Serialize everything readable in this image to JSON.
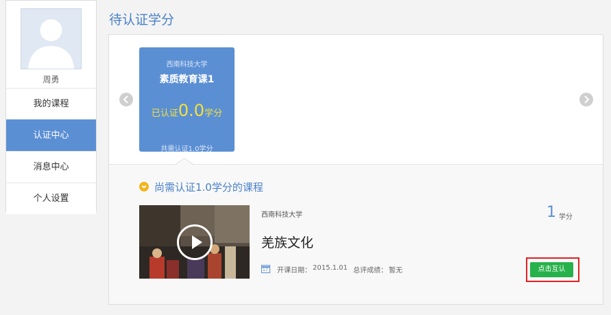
{
  "sidebar": {
    "user_name": "周勇",
    "nav": [
      {
        "label": "我的课程",
        "active": false
      },
      {
        "label": "认证中心",
        "active": true
      },
      {
        "label": "消息中心",
        "active": false
      },
      {
        "label": "个人设置",
        "active": false
      }
    ]
  },
  "main": {
    "title": "待认证学分"
  },
  "card": {
    "school": "西南科技大学",
    "course": "素质教育课1",
    "cert_prefix": "已认证",
    "cert_value": "0.0",
    "cert_suffix": "学分",
    "need": "共需认证1.0学分"
  },
  "section": {
    "title": "尚需认证1.0学分的课程"
  },
  "course": {
    "school": "西南科技大学",
    "name": "羌族文化",
    "date_label": "开课日期：",
    "date": "2015.1.01",
    "score_label": "总评成绩：",
    "score": "暂无",
    "credit": "1",
    "credit_unit": "学分",
    "button": "点击互认"
  },
  "colors": {
    "accent": "#5b8fd4",
    "highlight_yellow": "#f4e13a",
    "button_green": "#27b14a",
    "annotation_red": "#e02020"
  }
}
